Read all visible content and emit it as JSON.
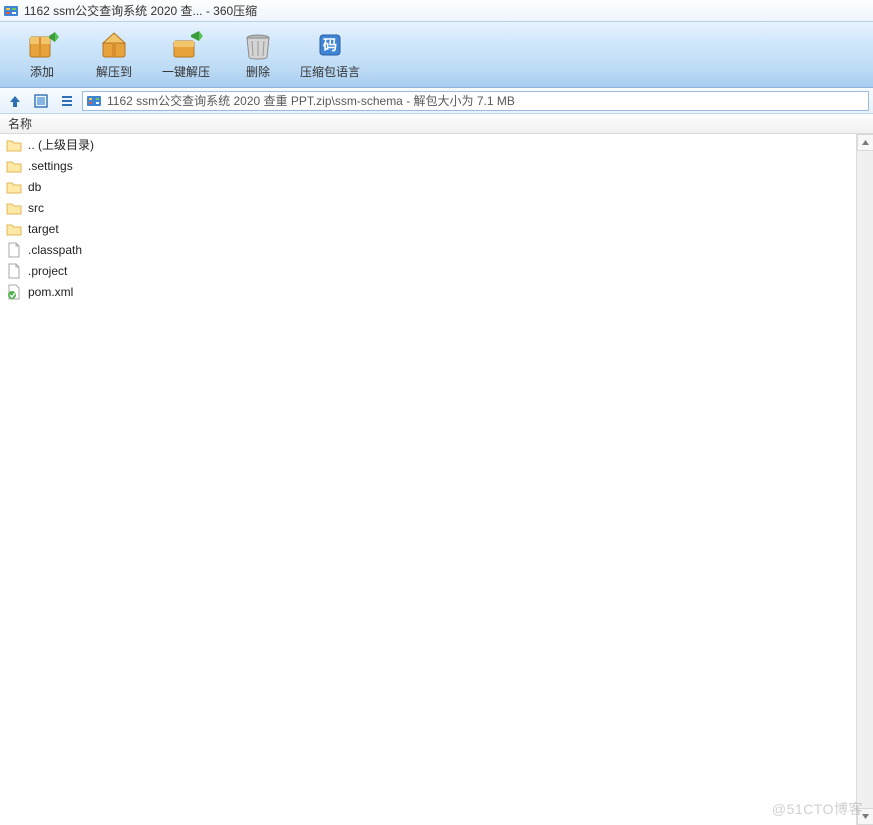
{
  "window": {
    "title": "1162 ssm公交查询系统 2020 查... - 360压缩"
  },
  "toolbar": {
    "buttons": [
      {
        "key": "add",
        "label": "添加"
      },
      {
        "key": "extract",
        "label": "解压到"
      },
      {
        "key": "one_click",
        "label": "一键解压"
      },
      {
        "key": "delete",
        "label": "删除"
      },
      {
        "key": "language",
        "label": "压缩包语言"
      }
    ]
  },
  "nav": {
    "path": "1162 ssm公交查询系统 2020 查重 PPT.zip\\ssm-schema - 解包大小为 7.1 MB"
  },
  "columns": {
    "name": "名称"
  },
  "files": [
    {
      "name": ".. (上级目录)",
      "type": "up"
    },
    {
      "name": ".settings",
      "type": "folder"
    },
    {
      "name": "db",
      "type": "folder"
    },
    {
      "name": "src",
      "type": "folder"
    },
    {
      "name": "target",
      "type": "folder"
    },
    {
      "name": ".classpath",
      "type": "file"
    },
    {
      "name": ".project",
      "type": "file"
    },
    {
      "name": "pom.xml",
      "type": "xml"
    }
  ],
  "watermark": "@51CTO博客"
}
